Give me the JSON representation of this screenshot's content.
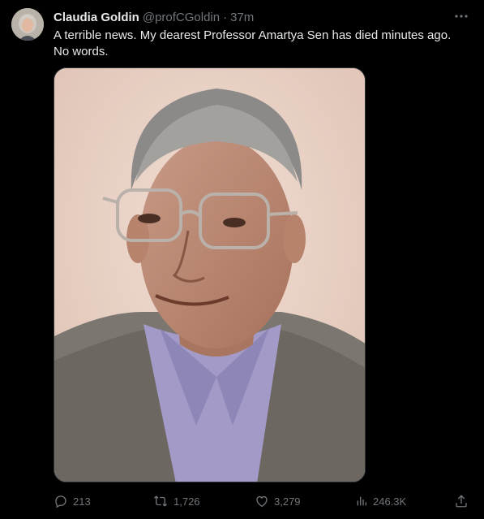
{
  "tweet": {
    "author": {
      "display_name": "Claudia Goldin",
      "handle": "@profCGoldin",
      "separator": "·",
      "timestamp": "37m"
    },
    "text": "A terrible news. My dearest Professor Amartya Sen has died minutes ago.\nNo words.",
    "media": {
      "type": "photo",
      "subject": "portrait"
    },
    "stats": {
      "replies": "213",
      "reposts": "1,726",
      "likes": "3,279",
      "views": "246.3K"
    },
    "icons": {
      "more": "more-options-icon",
      "reply": "reply-icon",
      "repost": "repost-icon",
      "like": "heart-icon",
      "views": "views-icon",
      "share": "share-icon"
    }
  },
  "theme": {
    "background": "#000000",
    "primary_text": "#e7e9ea",
    "secondary_text": "#71767b",
    "border": "#2f3336"
  }
}
